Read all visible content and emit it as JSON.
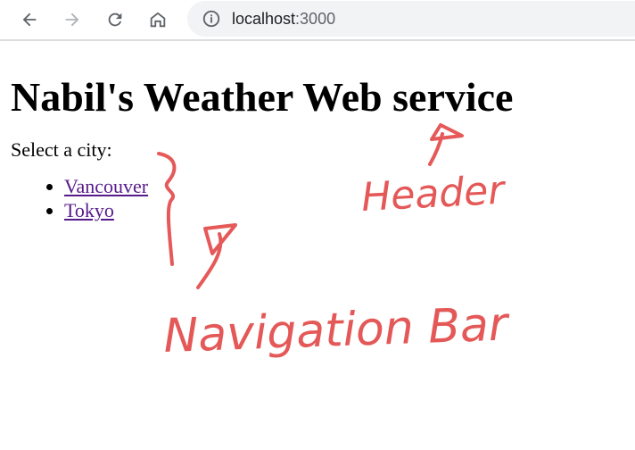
{
  "browser": {
    "url_host": "localhost",
    "url_port": ":3000",
    "icons": {
      "back": "arrow-left-icon",
      "forward": "arrow-right-icon",
      "reload": "reload-icon",
      "home": "home-icon",
      "info": "info-icon"
    }
  },
  "page": {
    "title": "Nabil's Weather Web service",
    "prompt": "Select a city:",
    "cities": [
      {
        "label": "Vancouver"
      },
      {
        "label": "Tokyo"
      }
    ]
  },
  "annotations": {
    "header_label": "Header",
    "nav_label": "Navigation Bar",
    "color": "#e03c3c"
  }
}
